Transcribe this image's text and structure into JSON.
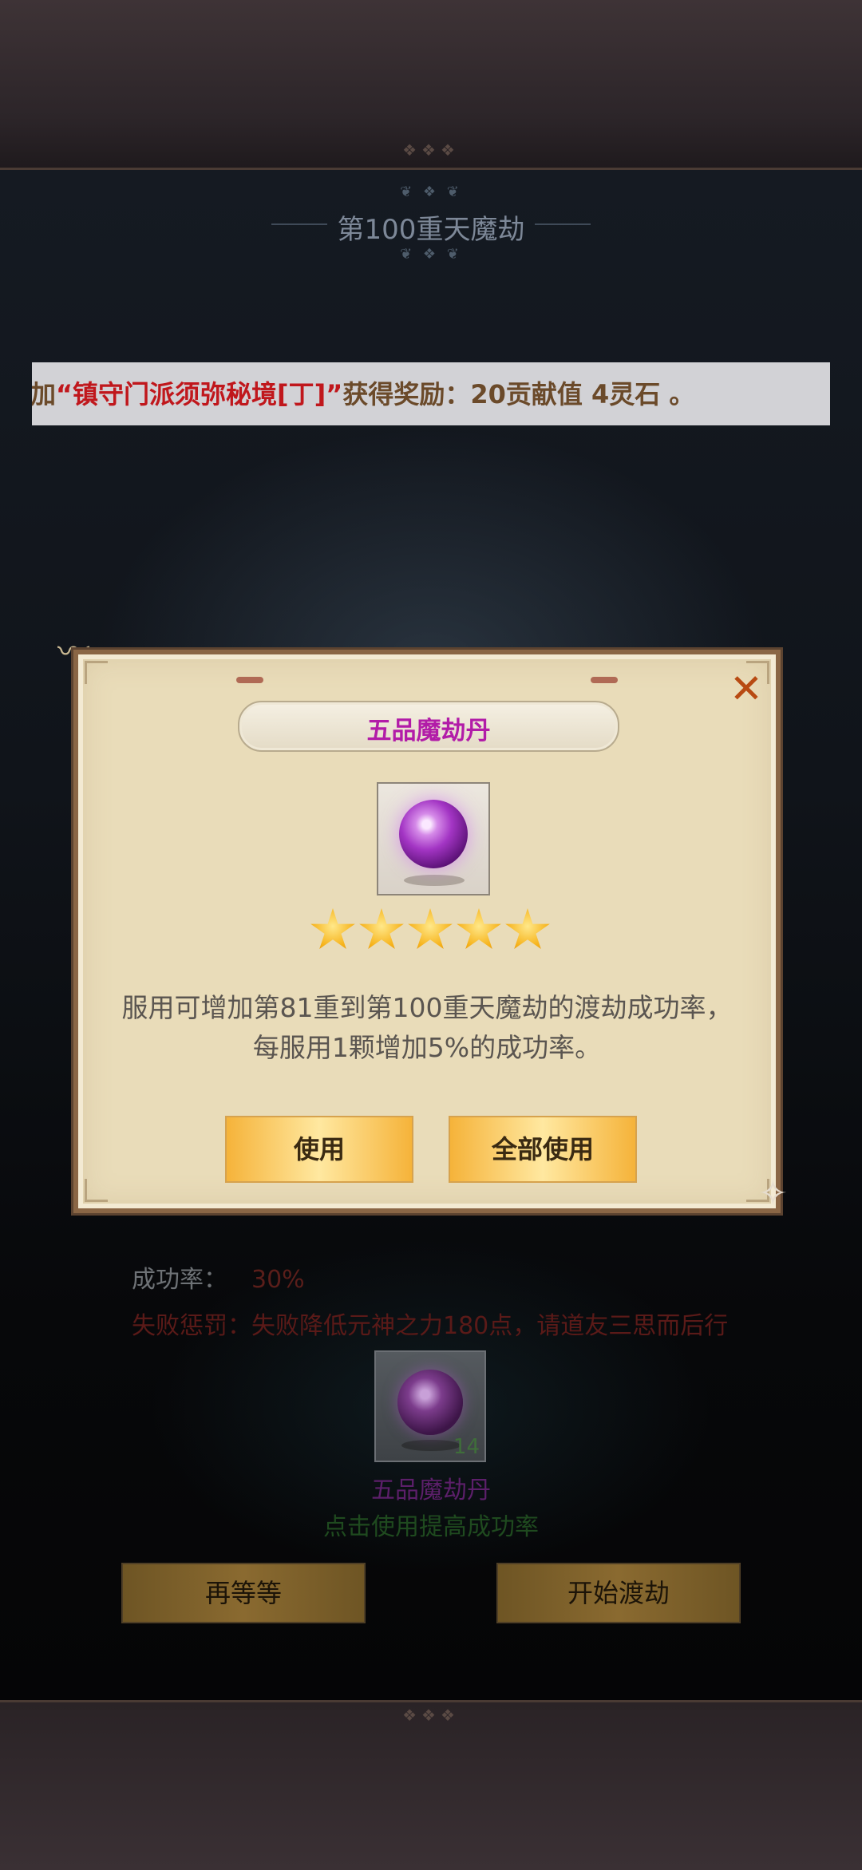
{
  "header": {
    "title": "第100重天魔劫"
  },
  "banner": {
    "prefix": "加",
    "quoted_name": "“镇守门派须弥秘境[丁]”",
    "reward_text": "获得奖励：20贡献值 4灵石 。"
  },
  "tribulation": {
    "success_rate_label": "成功率：",
    "success_rate_value": "30%",
    "penalty_text": "失败惩罚：失败降低元神之力180点，请道友三思而后行",
    "item": {
      "name": "五品魔劫丹",
      "count": "14",
      "hint": "点击使用提高成功率",
      "icon": "purple-orb-icon"
    },
    "buttons": {
      "wait_label": "再等等",
      "start_label": "开始渡劫"
    }
  },
  "modal": {
    "title": "五品魔劫丹",
    "close_icon": "close-x-icon",
    "item_icon": "purple-orb-icon",
    "stars": 5,
    "description_lines": [
      "服用可增加第81重到第100重天魔劫的渡劫成功率，",
      "每服用1颗增加5%的成功率。"
    ],
    "buttons": {
      "use_label": "使用",
      "use_all_label": "全部使用"
    }
  },
  "colors": {
    "modal_title": "#b21ca8",
    "banner_highlight": "#c0171c",
    "close_icon": "#b84a12",
    "star": "#f6b21a"
  }
}
